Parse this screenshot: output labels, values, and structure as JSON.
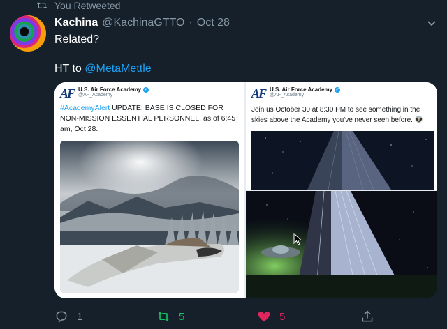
{
  "retweet_banner": {
    "icon": "retweet-icon",
    "text": "You Retweeted"
  },
  "tweet": {
    "name": "Kachina",
    "handle": "@KachinaGTTO",
    "separator": "·",
    "date": "Oct 28",
    "line1": "Related?",
    "line2_prefix": "HT to",
    "mention": "@MetaMettle"
  },
  "media": {
    "left": {
      "logo": "AF",
      "account_name": "U.S. Air Force Academy",
      "account_handle": "@AF_Academy",
      "hashtag": "#AcademyAlert",
      "text": " UPDATE: BASE IS CLOSED FOR NON-MISSION ESSENTIAL PERSONNEL, as of 6:45 am, Oct 28."
    },
    "right_top": {
      "logo": "AF",
      "account_name": "U.S. Air Force Academy",
      "account_handle": "@AF_Academy",
      "text": "Join us October 30 at 8:30 PM to see something in the skies above the Academy you've never seen before. 👽"
    },
    "right_bottom": {
      "image": "chapel-ufo-photo"
    }
  },
  "actions": {
    "reply_count": "1",
    "retweet_count": "5",
    "like_count": "5"
  },
  "colors": {
    "background": "#15202b",
    "secondary_text": "#8899a6",
    "link": "#1da1f2",
    "retweeted": "#17bf63",
    "liked": "#e0245e"
  }
}
